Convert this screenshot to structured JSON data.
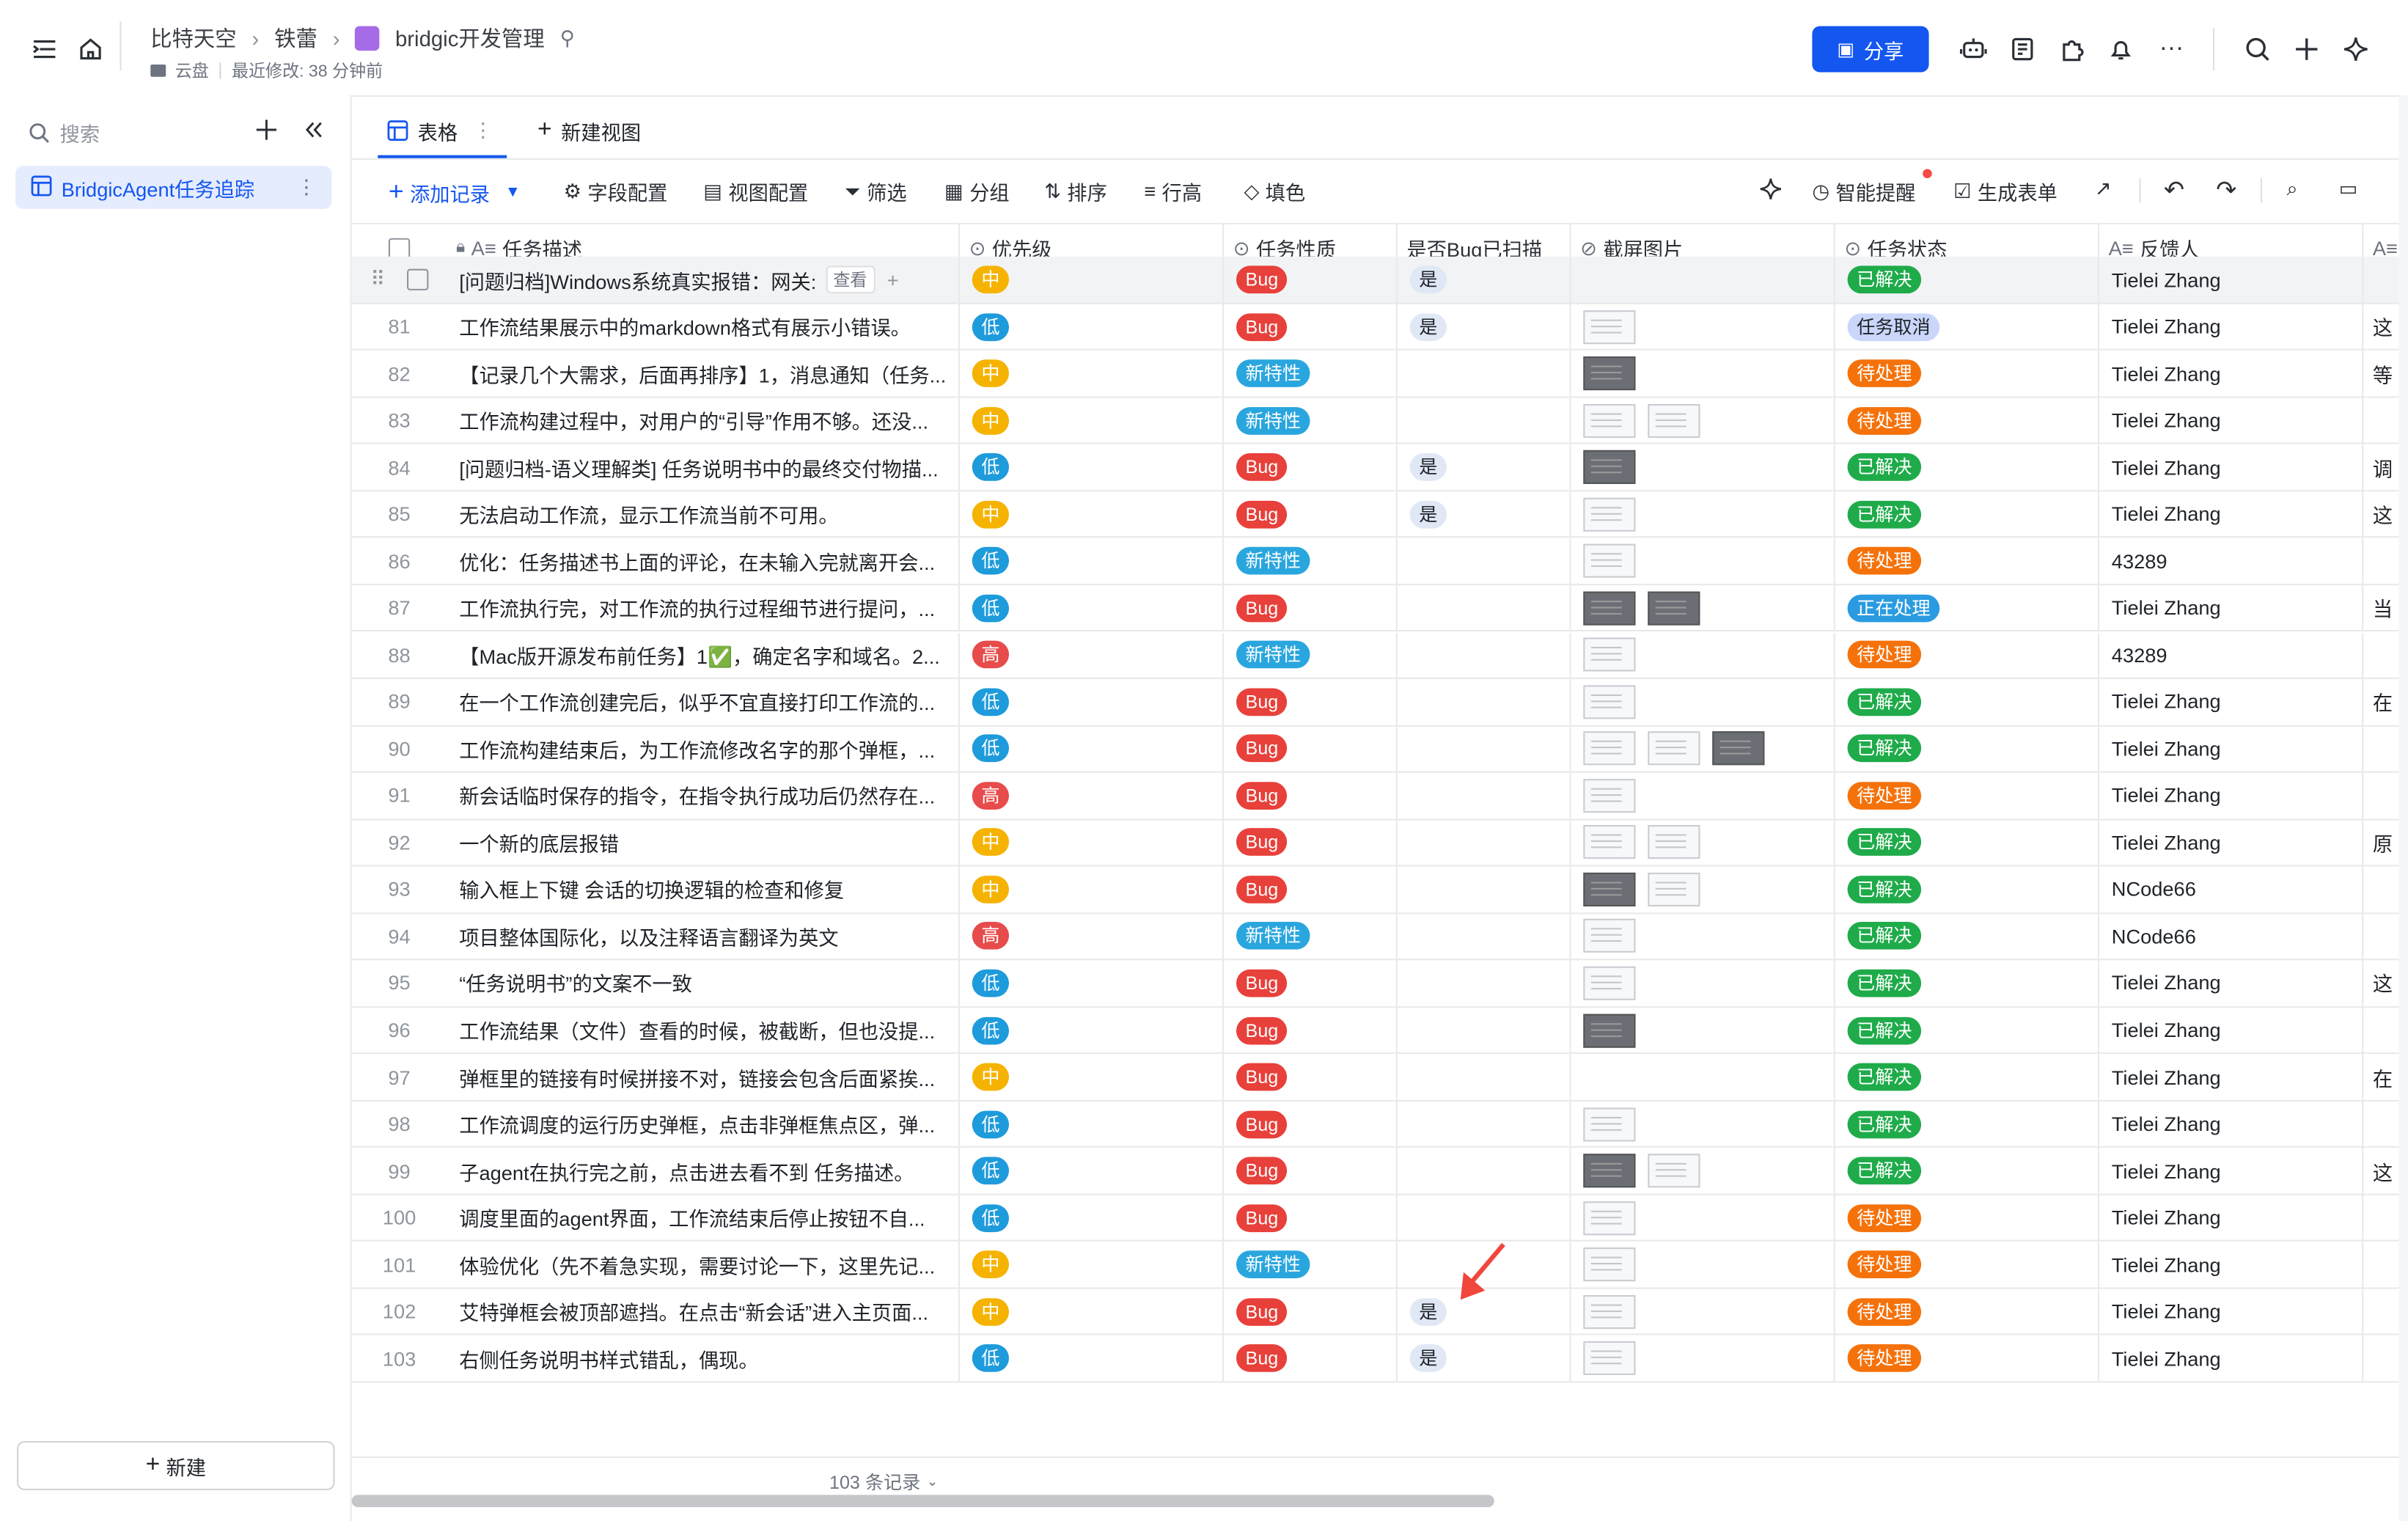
{
  "breadcrumb": {
    "items": [
      "比特天空",
      "铁蕾",
      "bridgic开发管理"
    ]
  },
  "meta": {
    "location": "云盘",
    "last_modified": "最近修改: 38 分钟前"
  },
  "header": {
    "share_label": "分享"
  },
  "sidebar": {
    "search_placeholder": "搜索",
    "items": [
      {
        "label": "BridgicAgent任务追踪"
      }
    ],
    "new_label": "新建"
  },
  "views": {
    "table_label": "表格",
    "new_view_label": "新建视图"
  },
  "toolbar": {
    "add_record": "添加记录",
    "field_config": "字段配置",
    "view_config": "视图配置",
    "filter": "筛选",
    "group": "分组",
    "sort": "排序",
    "row_height": "行高",
    "fill": "填色",
    "smart_remind": "智能提醒",
    "gen_form": "生成表单"
  },
  "columns": [
    "任务描述",
    "优先级",
    "任务性质",
    "是否Bug已扫描",
    "截屏图片",
    "任务状态",
    "反馈人"
  ],
  "partial_row": {
    "desc": "[问题归档]Windows系统真实报错：网关:",
    "view_label": "查看",
    "priority": "中",
    "type": "Bug",
    "scanned": "是",
    "status": "已解决",
    "feedback": "Tielei Zhang"
  },
  "rows": [
    {
      "n": "81",
      "desc": "工作流结果展示中的markdown格式有展示小错误。",
      "priority": "低",
      "type": "Bug",
      "scanned": "是",
      "thumbs": 1,
      "status": "任务取消",
      "feedback": "Tielei Zhang",
      "extra": "这"
    },
    {
      "n": "82",
      "desc": "【记录几个大需求，后面再排序】1，消息通知（任务...",
      "priority": "中",
      "type": "新特性",
      "scanned": "",
      "thumbs": 1,
      "status": "待处理",
      "feedback": "Tielei Zhang",
      "extra": "等"
    },
    {
      "n": "83",
      "desc": "工作流构建过程中，对用户的“引导”作用不够。还没...",
      "priority": "中",
      "type": "新特性",
      "scanned": "",
      "thumbs": 2,
      "status": "待处理",
      "feedback": "Tielei Zhang",
      "extra": ""
    },
    {
      "n": "84",
      "desc": "[问题归档-语义理解类] 任务说明书中的最终交付物描...",
      "priority": "低",
      "type": "Bug",
      "scanned": "是",
      "thumbs": 1,
      "status": "已解决",
      "feedback": "Tielei Zhang",
      "extra": "调"
    },
    {
      "n": "85",
      "desc": "无法启动工作流，显示工作流当前不可用。",
      "priority": "中",
      "type": "Bug",
      "scanned": "是",
      "thumbs": 1,
      "status": "已解决",
      "feedback": "Tielei Zhang",
      "extra": "这"
    },
    {
      "n": "86",
      "desc": "优化：任务描述书上面的评论，在未输入完就离开会...",
      "priority": "低",
      "type": "新特性",
      "scanned": "",
      "thumbs": 1,
      "status": "待处理",
      "feedback": "43289",
      "extra": ""
    },
    {
      "n": "87",
      "desc": "工作流执行完，对工作流的执行过程细节进行提问，...",
      "priority": "低",
      "type": "Bug",
      "scanned": "",
      "thumbs": 2,
      "status": "正在处理",
      "feedback": "Tielei Zhang",
      "extra": "当"
    },
    {
      "n": "88",
      "desc": "【Mac版开源发布前任务】1✅，确定名字和域名。2...",
      "priority": "高",
      "type": "新特性",
      "scanned": "",
      "thumbs": 1,
      "status": "待处理",
      "feedback": "43289",
      "extra": ""
    },
    {
      "n": "89",
      "desc": "在一个工作流创建完后，似乎不宜直接打印工作流的...",
      "priority": "低",
      "type": "Bug",
      "scanned": "",
      "thumbs": 1,
      "status": "已解决",
      "feedback": "Tielei Zhang",
      "extra": "在"
    },
    {
      "n": "90",
      "desc": "工作流构建结束后，为工作流修改名字的那个弹框，...",
      "priority": "低",
      "type": "Bug",
      "scanned": "",
      "thumbs": 3,
      "status": "已解决",
      "feedback": "Tielei Zhang",
      "extra": ""
    },
    {
      "n": "91",
      "desc": "新会话临时保存的指令，在指令执行成功后仍然存在...",
      "priority": "高",
      "type": "Bug",
      "scanned": "",
      "thumbs": 1,
      "status": "待处理",
      "feedback": "Tielei Zhang",
      "extra": ""
    },
    {
      "n": "92",
      "desc": "一个新的底层报错",
      "priority": "中",
      "type": "Bug",
      "scanned": "",
      "thumbs": 2,
      "status": "已解决",
      "feedback": "Tielei Zhang",
      "extra": "原"
    },
    {
      "n": "93",
      "desc": "输入框上下键 会话的切换逻辑的检查和修复",
      "priority": "中",
      "type": "Bug",
      "scanned": "",
      "thumbs": 2,
      "status": "已解决",
      "feedback": "NCode66",
      "extra": ""
    },
    {
      "n": "94",
      "desc": "项目整体国际化，以及注释语言翻译为英文",
      "priority": "高",
      "type": "新特性",
      "scanned": "",
      "thumbs": 1,
      "status": "已解决",
      "feedback": "NCode66",
      "extra": ""
    },
    {
      "n": "95",
      "desc": "“任务说明书”的文案不一致",
      "priority": "低",
      "type": "Bug",
      "scanned": "",
      "thumbs": 1,
      "status": "已解决",
      "feedback": "Tielei Zhang",
      "extra": "这"
    },
    {
      "n": "96",
      "desc": "工作流结果（文件）查看的时候，被截断，但也没提...",
      "priority": "低",
      "type": "Bug",
      "scanned": "",
      "thumbs": 1,
      "status": "已解决",
      "feedback": "Tielei Zhang",
      "extra": ""
    },
    {
      "n": "97",
      "desc": "弹框里的链接有时候拼接不对，链接会包含后面紧挨...",
      "priority": "中",
      "type": "Bug",
      "scanned": "",
      "thumbs": 0,
      "status": "已解决",
      "feedback": "Tielei Zhang",
      "extra": "在"
    },
    {
      "n": "98",
      "desc": "工作流调度的运行历史弹框，点击非弹框焦点区，弹...",
      "priority": "低",
      "type": "Bug",
      "scanned": "",
      "thumbs": 1,
      "status": "已解决",
      "feedback": "Tielei Zhang",
      "extra": ""
    },
    {
      "n": "99",
      "desc": "子agent在执行完之前，点击进去看不到 任务描述。",
      "priority": "低",
      "type": "Bug",
      "scanned": "",
      "thumbs": 2,
      "status": "已解决",
      "feedback": "Tielei Zhang",
      "extra": "这"
    },
    {
      "n": "100",
      "desc": "调度里面的agent界面，工作流结束后停止按钮不自...",
      "priority": "低",
      "type": "Bug",
      "scanned": "",
      "thumbs": 1,
      "status": "待处理",
      "feedback": "Tielei Zhang",
      "extra": ""
    },
    {
      "n": "101",
      "desc": "体验优化（先不着急实现，需要讨论一下，这里先记...",
      "priority": "中",
      "type": "新特性",
      "scanned": "",
      "thumbs": 1,
      "status": "待处理",
      "feedback": "Tielei Zhang",
      "extra": ""
    },
    {
      "n": "102",
      "desc": "艾特弹框会被顶部遮挡。在点击“新会话”进入主页面...",
      "priority": "中",
      "type": "Bug",
      "scanned": "是",
      "thumbs": 1,
      "status": "待处理",
      "feedback": "Tielei Zhang",
      "extra": ""
    },
    {
      "n": "103",
      "desc": "右侧任务说明书样式错乱，偶现。",
      "priority": "低",
      "type": "Bug",
      "scanned": "是",
      "thumbs": 1,
      "status": "待处理",
      "feedback": "Tielei Zhang",
      "extra": ""
    }
  ],
  "footer": {
    "record_count": "103 条记录"
  }
}
